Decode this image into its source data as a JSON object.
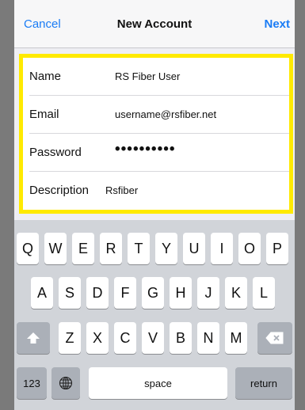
{
  "navbar": {
    "cancel_label": "Cancel",
    "title": "New Account",
    "next_label": "Next"
  },
  "form": {
    "rows": [
      {
        "label": "Name",
        "value": "RS Fiber User"
      },
      {
        "label": "Email",
        "value": "username@rsfiber.net"
      },
      {
        "label": "Password",
        "value": "••••••••••"
      },
      {
        "label": "Description",
        "value": "Rsfiber"
      }
    ]
  },
  "keyboard": {
    "row1": [
      "Q",
      "W",
      "E",
      "R",
      "T",
      "Y",
      "U",
      "I",
      "O",
      "P"
    ],
    "row2": [
      "A",
      "S",
      "D",
      "F",
      "G",
      "H",
      "J",
      "K",
      "L"
    ],
    "row3": [
      "Z",
      "X",
      "C",
      "V",
      "B",
      "N",
      "M"
    ],
    "numbers_label": "123",
    "space_label": "space",
    "return_label": "return",
    "shift_icon": "shift-arrow-icon",
    "delete_icon": "backspace-icon",
    "globe_icon": "globe-icon"
  },
  "colors": {
    "accent": "#1a7cf5",
    "highlight_border": "#ffea00"
  }
}
